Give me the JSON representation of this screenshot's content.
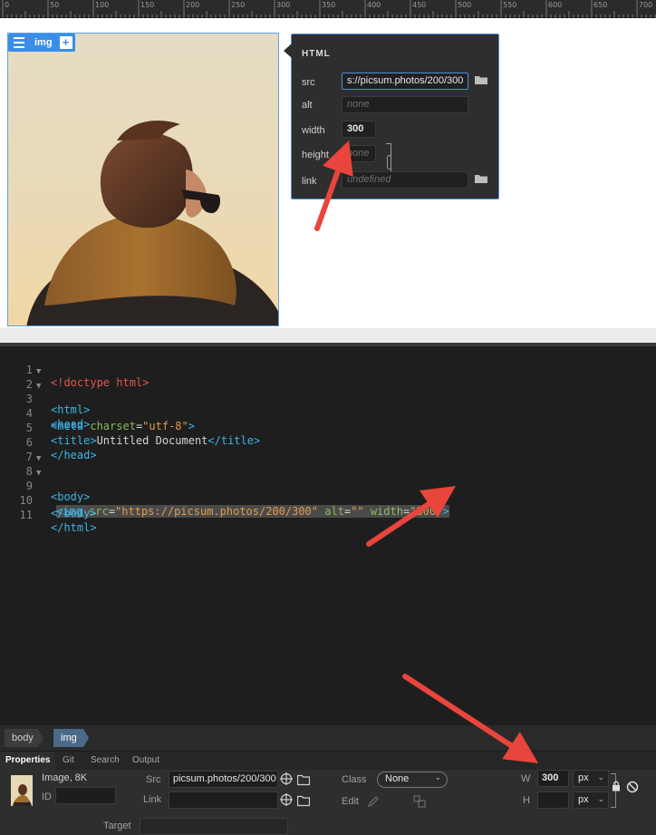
{
  "ruler": {
    "labels": [
      "0",
      "50",
      "100",
      "150",
      "200",
      "250",
      "300",
      "350",
      "400",
      "450",
      "500",
      "550",
      "600",
      "650",
      "700"
    ]
  },
  "element_badge": {
    "menu_icon": "hamburger-icon",
    "tag": "img",
    "add_icon": "plus-icon",
    "add_label": "+"
  },
  "hud": {
    "title": "HTML",
    "src_label": "src",
    "src_value": "s://picsum.photos/200/300",
    "alt_label": "alt",
    "alt_placeholder": "none",
    "width_label": "width",
    "width_value": "300",
    "height_label": "height",
    "height_placeholder": "none",
    "link_label": "link",
    "link_placeholder": "undefined",
    "folder_icon": "folder-icon",
    "chain_icon": "chain-link-icon"
  },
  "code": {
    "lines": [
      {
        "n": "1",
        "fold": ""
      },
      {
        "n": "2",
        "fold": "▼"
      },
      {
        "n": "3",
        "fold": "▼"
      },
      {
        "n": "4",
        "fold": ""
      },
      {
        "n": "5",
        "fold": ""
      },
      {
        "n": "6",
        "fold": ""
      },
      {
        "n": "7",
        "fold": ""
      },
      {
        "n": "8",
        "fold": "▼"
      },
      {
        "n": "9",
        "fold": "▼"
      },
      {
        "n": "10",
        "fold": ""
      },
      {
        "n": "11",
        "fold": ""
      }
    ],
    "tokens": {
      "l1": "<!doctype html>",
      "l2": "<html>",
      "l3": "<head>",
      "l4_open": "<meta ",
      "l4_attr": "charset",
      "l4_eq": "=",
      "l4_val": "\"utf-8\"",
      "l4_close": ">",
      "l5_open": "<title>",
      "l5_text": "Untitled Document",
      "l5_close": "</title>",
      "l6": "</head>",
      "l8": "<body>",
      "l9_open": "<img ",
      "l9_a1": "src",
      "l9_eq1": "=",
      "l9_v1": "\"https://picsum.photos/200/300\"",
      "l9_a2": " alt",
      "l9_eq2": "=",
      "l9_v2": "\"\"",
      "l9_a3": " width",
      "l9_eq3": "=",
      "l9_v3": "\"300\"",
      "l9_close": ">",
      "l10": "</body>",
      "l11": "</html>"
    }
  },
  "tag_selector": {
    "items": [
      "body",
      "img"
    ]
  },
  "properties": {
    "tabs": [
      "Properties",
      "Git",
      "Search",
      "Output"
    ],
    "active_tab": "Properties",
    "type_info": "Image, 8K",
    "id_label": "ID",
    "id_value": "",
    "src_label": "Src",
    "src_value": "picsum.photos/200/300",
    "link_label": "Link",
    "link_value": "",
    "class_label": "Class",
    "class_value": "None",
    "edit_label": "Edit",
    "w_label": "W",
    "w_value": "300",
    "w_unit": "px",
    "h_label": "H",
    "h_value": "",
    "h_unit": "px",
    "target_label": "Target",
    "target_value": "",
    "icons": [
      "target-icon",
      "folder-icon",
      "pencil-icon",
      "resample-icon",
      "lock-icon",
      "no-icon"
    ]
  },
  "annotations": {
    "arrows": 3,
    "color": "#e8453c"
  }
}
